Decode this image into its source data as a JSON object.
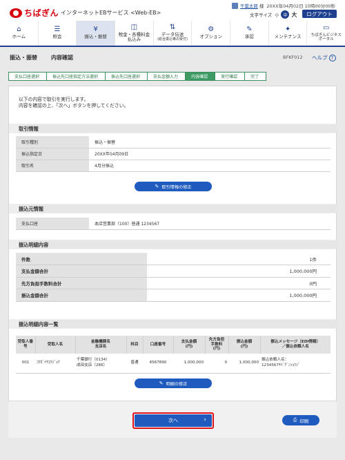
{
  "header": {
    "brand": "ちばぎん",
    "service_name": "インターネットEBサービス <Web-EB>",
    "user_name": "千葉太郎",
    "user_suffix": "様",
    "last_login": "20XX年04月02日 10時00分00秒",
    "font_size_label": "文字サイズ",
    "font_sizes": [
      "小",
      "中",
      "大"
    ],
    "logout": "ログアウト"
  },
  "nav": [
    {
      "icon": "⌂",
      "label": "ホーム"
    },
    {
      "icon": "☰",
      "label": "照会"
    },
    {
      "icon": "¥",
      "label": "振込・振替"
    },
    {
      "icon": "◫",
      "label": "税金・各種料金払込み"
    },
    {
      "icon": "⇅",
      "label": "データ伝送",
      "sub": "(総合振込等の受付)"
    },
    {
      "icon": "⚙",
      "label": "オプション"
    },
    {
      "icon": "✎",
      "label": "承認"
    },
    {
      "icon": "✦",
      "label": "メンテナンス"
    },
    {
      "icon": "▭",
      "label": "ちばぎんビジネスポータル"
    }
  ],
  "page": {
    "category": "振込・振替",
    "title": "内容確認",
    "screen_id": "BFKF012",
    "help": "ヘルプ"
  },
  "steps": [
    "支払口座選択",
    "振込先口座指定方法選択",
    "振込先口座選択",
    "支払金額入力",
    "内容確認",
    "実行確認",
    "完了"
  ],
  "intro": [
    "以下の内容で取引を実行します。",
    "内容を確認の上、「次へ」ボタンを押してください。"
  ],
  "transaction": {
    "heading": "取引情報",
    "rows": [
      {
        "k": "取引種別",
        "v": "振込・振替"
      },
      {
        "k": "振込指定日",
        "v": "20XX年04月09日"
      },
      {
        "k": "取引名",
        "v": "4月分振込"
      }
    ],
    "edit_button": "取引情報の修正"
  },
  "source": {
    "heading": "振込元情報",
    "rows": [
      {
        "k": "支払口座",
        "v": "本店営業部（100）普通 1234567"
      }
    ]
  },
  "detail": {
    "heading": "振込明細内容",
    "rows": [
      {
        "k": "件数",
        "v": "1件"
      },
      {
        "k": "支払金額合計",
        "v": "1,000,000円"
      },
      {
        "k": "先方負担手数料合計",
        "v": "0円"
      },
      {
        "k": "振込金額合計",
        "v": "1,000,000円"
      }
    ]
  },
  "list": {
    "heading": "振込明細内容一覧",
    "headers": [
      "受取人番号",
      "受取人名",
      "金融機関名\n支店名",
      "科目",
      "口座番号",
      "支払金額\n(円)",
      "先方負担\n手数料\n(円)",
      "振込金額\n(円)",
      "振込メッセージ（EDI情報）\n／振込依頼人名"
    ],
    "rows": [
      {
        "no": "001",
        "name": "ｺｳｶﾞｲﾁｺｳｼﾞｮｳ",
        "bank": "千葉銀行（0134）",
        "branch": "成田支店（286）",
        "type": "普通",
        "account": "4567890",
        "pay": "1,000,000",
        "fee": "0",
        "amount": "1,000,000",
        "msg1": "振込依頼人名：",
        "msg2": "1234567ﾁﾊﾞｸﾞﾝｼｮｳｼﾞ"
      }
    ],
    "edit_button": "明細の修正"
  },
  "actions": {
    "next": "次へ",
    "print": "印刷"
  },
  "colors": {
    "brand_red": "#d7000f",
    "navy": "#1f3f8f",
    "button_blue": "#1f5bbf",
    "step_green": "#3c9a62"
  }
}
